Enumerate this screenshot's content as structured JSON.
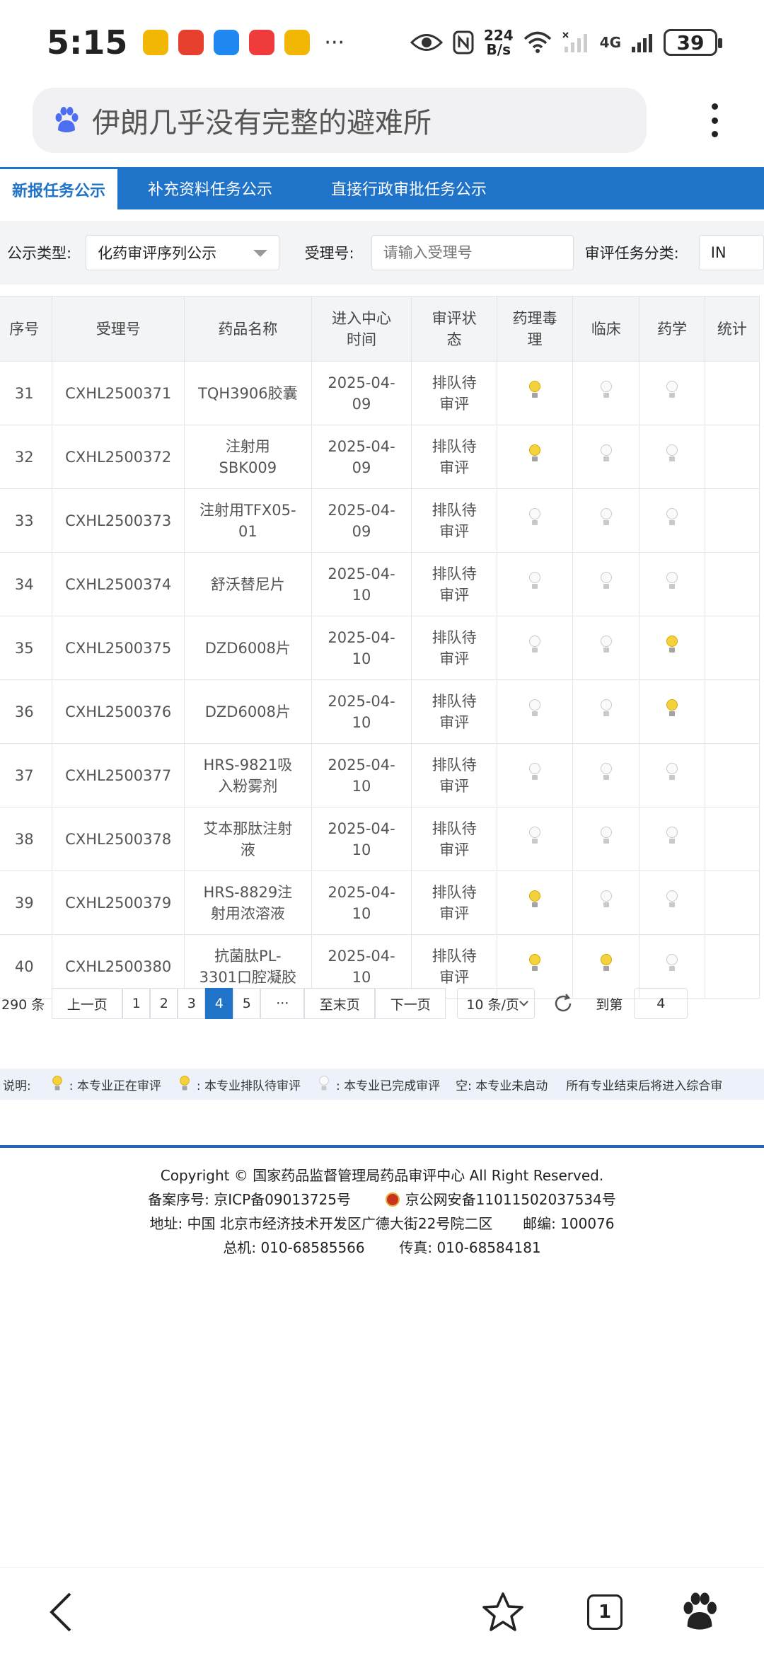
{
  "status_bar": {
    "time": "5:15",
    "net_speed_value": "224",
    "net_speed_unit": "B/s",
    "network": "4G",
    "battery": "39",
    "dots": "···"
  },
  "search": {
    "query": "伊朗几乎没有完整的避难所"
  },
  "tabs": [
    {
      "label": "新报任务公示",
      "active": true
    },
    {
      "label": "补充资料任务公示",
      "active": false
    },
    {
      "label": "直接行政审批任务公示",
      "active": false
    }
  ],
  "filters": {
    "type_label": "公示类型:",
    "type_value": "化药审评序列公示",
    "acceptance_label": "受理号:",
    "acceptance_placeholder": "请输入受理号",
    "category_label": "审评任务分类:",
    "category_value": "IN"
  },
  "table": {
    "headers": [
      "序号",
      "受理号",
      "药品名称",
      "进入中心时间",
      "审评状态",
      "药理毒理",
      "临床",
      "药学",
      "统计"
    ],
    "headers_display": [
      [
        "序号"
      ],
      [
        "受理号"
      ],
      [
        "药品名称"
      ],
      [
        "进入中心",
        "时间"
      ],
      [
        "审评状",
        "态"
      ],
      [
        "药理毒",
        "理"
      ],
      [
        "临床"
      ],
      [
        "药学"
      ],
      [
        "统计"
      ]
    ],
    "rows": [
      {
        "no": "31",
        "id": "CXHL2500371",
        "name": [
          "TQH3906胶囊"
        ],
        "date": [
          "2025-04-",
          "09"
        ],
        "status": [
          "排队待",
          "审评"
        ],
        "bulbs": [
          true,
          false,
          false
        ]
      },
      {
        "no": "32",
        "id": "CXHL2500372",
        "name": [
          "注射用",
          "SBK009"
        ],
        "date": [
          "2025-04-",
          "09"
        ],
        "status": [
          "排队待",
          "审评"
        ],
        "bulbs": [
          true,
          false,
          false
        ]
      },
      {
        "no": "33",
        "id": "CXHL2500373",
        "name": [
          "注射用TFX05-",
          "01"
        ],
        "date": [
          "2025-04-",
          "09"
        ],
        "status": [
          "排队待",
          "审评"
        ],
        "bulbs": [
          false,
          false,
          false
        ]
      },
      {
        "no": "34",
        "id": "CXHL2500374",
        "name": [
          "舒沃替尼片"
        ],
        "date": [
          "2025-04-",
          "10"
        ],
        "status": [
          "排队待",
          "审评"
        ],
        "bulbs": [
          false,
          false,
          false
        ]
      },
      {
        "no": "35",
        "id": "CXHL2500375",
        "name": [
          "DZD6008片"
        ],
        "date": [
          "2025-04-",
          "10"
        ],
        "status": [
          "排队待",
          "审评"
        ],
        "bulbs": [
          false,
          false,
          true
        ]
      },
      {
        "no": "36",
        "id": "CXHL2500376",
        "name": [
          "DZD6008片"
        ],
        "date": [
          "2025-04-",
          "10"
        ],
        "status": [
          "排队待",
          "审评"
        ],
        "bulbs": [
          false,
          false,
          true
        ]
      },
      {
        "no": "37",
        "id": "CXHL2500377",
        "name": [
          "HRS-9821吸",
          "入粉雾剂"
        ],
        "date": [
          "2025-04-",
          "10"
        ],
        "status": [
          "排队待",
          "审评"
        ],
        "bulbs": [
          false,
          false,
          false
        ]
      },
      {
        "no": "38",
        "id": "CXHL2500378",
        "name": [
          "艾本那肽注射",
          "液"
        ],
        "date": [
          "2025-04-",
          "10"
        ],
        "status": [
          "排队待",
          "审评"
        ],
        "bulbs": [
          false,
          false,
          false
        ]
      },
      {
        "no": "39",
        "id": "CXHL2500379",
        "name": [
          "HRS-8829注",
          "射用浓溶液"
        ],
        "date": [
          "2025-04-",
          "10"
        ],
        "status": [
          "排队待",
          "审评"
        ],
        "bulbs": [
          true,
          false,
          false
        ]
      },
      {
        "no": "40",
        "id": "CXHL2500380",
        "name": [
          "抗菌肽PL-",
          "3301口腔凝胶"
        ],
        "date": [
          "2025-04-",
          "10"
        ],
        "status": [
          "排队待",
          "审评"
        ],
        "bulbs": [
          true,
          true,
          false
        ]
      }
    ]
  },
  "pagination": {
    "total": "290 条",
    "prev": "上一页",
    "pages": [
      "1",
      "2",
      "3",
      "4",
      "5"
    ],
    "current": "4",
    "ellipsis": "···",
    "last": "至末页",
    "next": "下一页",
    "page_size": "10 条/页",
    "goto_label": "到第",
    "goto_value": "4"
  },
  "legend": {
    "label": "说明:",
    "items": [
      {
        "text": ": 本专业正在审评",
        "bulb": "on"
      },
      {
        "text": ": 本专业排队待审评",
        "bulb": "on"
      },
      {
        "text": ": 本专业已完成审评",
        "bulb": "off"
      }
    ],
    "empty_note": "空: 本专业未启动",
    "final_note": "所有专业结束后将进入综合审"
  },
  "footer": {
    "copyright": "Copyright © 国家药品监督管理局药品审评中心   All Right Reserved.",
    "icp": "备案序号: 京ICP备09013725号",
    "police": "京公网安备11011502037534号",
    "address": "地址: 中国 北京市经济技术开发区广德大街22号院二区",
    "postcode": "邮编: 100076",
    "phone": "总机: 010-68585566",
    "fax": "传真: 010-68584181"
  },
  "bottom_nav": {
    "tab_count": "1"
  },
  "colors": {
    "accent": "#1f74c9",
    "bulb_on": "#f3d23e",
    "legend_bg": "#edf2fa"
  }
}
